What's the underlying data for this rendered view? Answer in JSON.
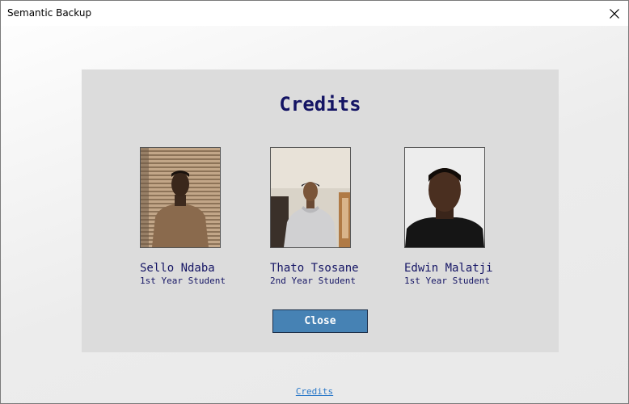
{
  "window": {
    "title": "Semantic Backup",
    "close_icon": "close-icon"
  },
  "dialog": {
    "title": "Credits",
    "close_label": "Close",
    "people": [
      {
        "name": "Sello Ndaba",
        "role": "1st Year Student"
      },
      {
        "name": "Thato Tsosane",
        "role": "2nd Year Student"
      },
      {
        "name": "Edwin Malatji",
        "role": "1st Year Student"
      }
    ]
  },
  "footer": {
    "link_label": "Credits"
  },
  "colors": {
    "accent_text": "#141464",
    "button": "#4682b4",
    "panel": "#dcdcdc",
    "link": "#2a78c8"
  }
}
